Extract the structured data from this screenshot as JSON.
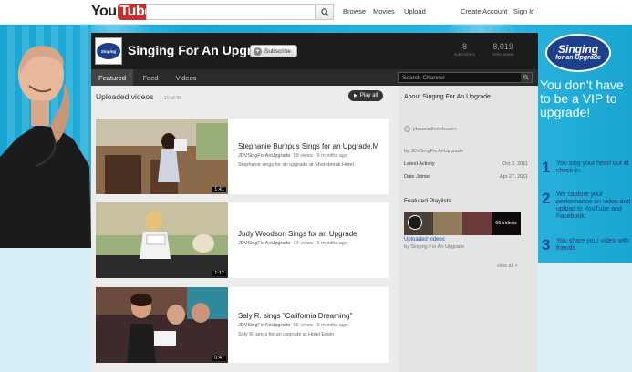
{
  "topbar": {
    "logo_you": "You",
    "logo_tube": "Tube",
    "search_placeholder": "",
    "nav": [
      "Browse",
      "Movies",
      "Upload"
    ],
    "create_account": "Create Account",
    "sign_in": "Sign In"
  },
  "channel": {
    "avatar_text": "Singing",
    "title": "Singing For An Upgrade",
    "subscribe_label": "Subscribe",
    "subscribers_count": "8",
    "subscribers_label": "subscribers",
    "views_count": "8,019",
    "views_label": "video views",
    "tabs": [
      "Featured",
      "Feed",
      "Videos"
    ],
    "search_placeholder": "Search Channel"
  },
  "uploads": {
    "title": "Uploaded videos",
    "count": "1-10 of 66",
    "play_all": "Play all",
    "videos": [
      {
        "title": "Stephanie Bumpus Sings for an Upgrade.M",
        "user": "JDVSingForAnUpgrade",
        "views": "59 views",
        "age": "9 months ago",
        "description": "Stephanie sings for an upgrade at Shorebreak Hotel.",
        "duration": "1:41"
      },
      {
        "title": "Judy Woodson Sings for an Upgrade",
        "user": "JDVSingForAnUpgrade",
        "views": "19 views",
        "age": "9 months ago",
        "description": "",
        "duration": "1:12"
      },
      {
        "title": "Saly R. sings \"California Dreaming\"",
        "user": "JDVSingForAnUpgrade",
        "views": "56 views",
        "age": "9 months ago",
        "description": "Saly R. sings for an upgrade at Hotel Erwin",
        "duration": "0:47"
      }
    ]
  },
  "about": {
    "title": "About Singing For An Upgrade",
    "link": "jdvsocialhotels.com",
    "by": "by JDVSingForAnUpgrade",
    "latest_activity_label": "Latest Activity",
    "latest_activity_value": "Oct 3, 2011",
    "date_joined_label": "Date Joined",
    "date_joined_value": "Apr 27, 2011",
    "featured_playlists_title": "Featured Playlists",
    "playlist_count": "66 videos",
    "playlist_name": "Uploaded videos",
    "playlist_by": "by Singing For An Upgrade",
    "view_all": "view all »"
  },
  "ad": {
    "logo_line1": "Singing",
    "logo_line2": "for an Upgrade",
    "headline": "You don't have to be a VIP to upgrade!",
    "steps": [
      {
        "num": "1",
        "text": "You sing your heart out at check-in."
      },
      {
        "num": "2",
        "text": "We capture your performance on video and upload to YouTube and Facebook."
      },
      {
        "num": "3",
        "text": "You share your video with friends."
      }
    ]
  },
  "colors": {
    "brand_red": "#c4302b",
    "background_blue": "#29b2dc",
    "ad_navy": "#1e3f8c"
  }
}
